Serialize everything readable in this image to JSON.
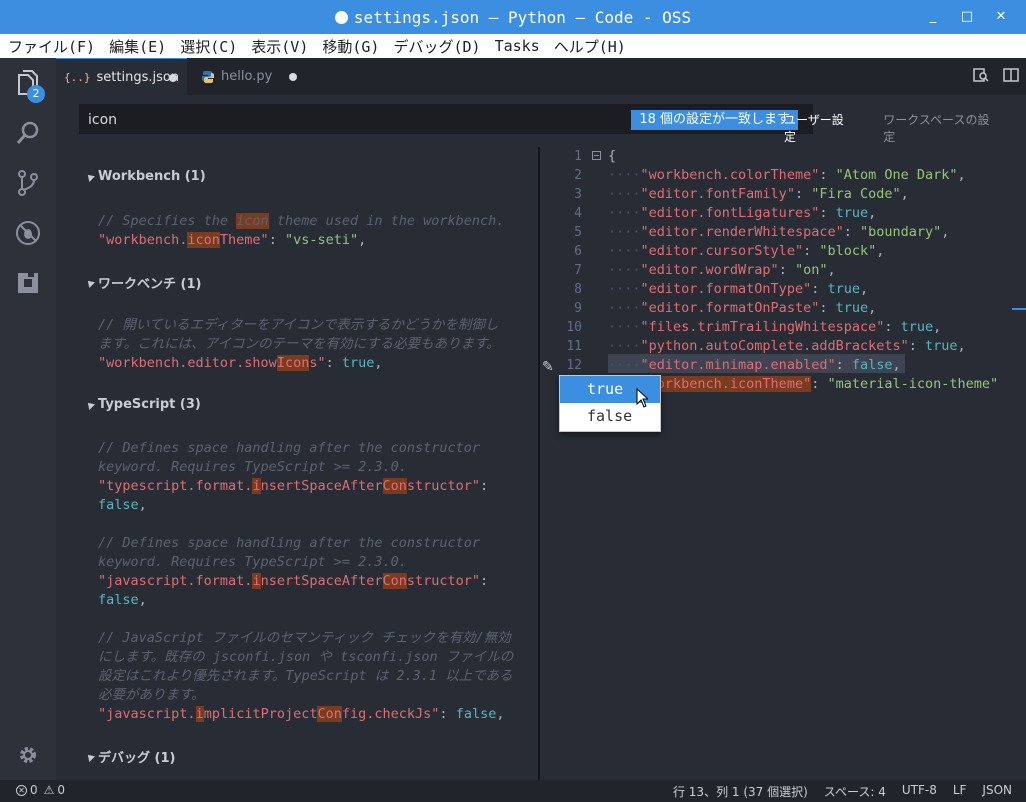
{
  "window": {
    "title": "settings.json — Python — Code - OSS",
    "controls": [
      "_",
      "□",
      "✕"
    ]
  },
  "menu": [
    "ファイル(F)",
    "編集(E)",
    "選択(C)",
    "表示(V)",
    "移動(G)",
    "デバッグ(D)",
    "Tasks",
    "ヘルプ(H)"
  ],
  "activity": {
    "explorer_badge": "2"
  },
  "tabs": [
    {
      "label": "settings.json",
      "icon": "{..}"
    },
    {
      "label": "hello.py"
    }
  ],
  "search": {
    "value": "icon",
    "result_count": "18 個の設定が一致します"
  },
  "scope_tabs": {
    "user": "ユーザー設定",
    "workspace": "ワークスペースの設定"
  },
  "default_settings": {
    "sections": [
      {
        "title": "Workbench (1)"
      },
      {
        "title": "ワークベンチ (1)"
      },
      {
        "title": "TypeScript (3)"
      },
      {
        "title": "デバッグ (1)"
      }
    ]
  },
  "editor": {
    "line_numbers": [
      "1",
      "2",
      "3",
      "4",
      "5",
      "6",
      "7",
      "8",
      "9",
      "10",
      "11",
      "12",
      "13"
    ],
    "current_line": "13",
    "accent": "#3c8fe0"
  },
  "suggestions": [
    "true",
    "false"
  ],
  "status": {
    "errors": "0",
    "warnings": "0",
    "position": "行 13、列 1 (37 個選択)",
    "spaces": "スペース: 4",
    "encoding": "UTF-8",
    "eol": "LF",
    "language": "JSON"
  }
}
